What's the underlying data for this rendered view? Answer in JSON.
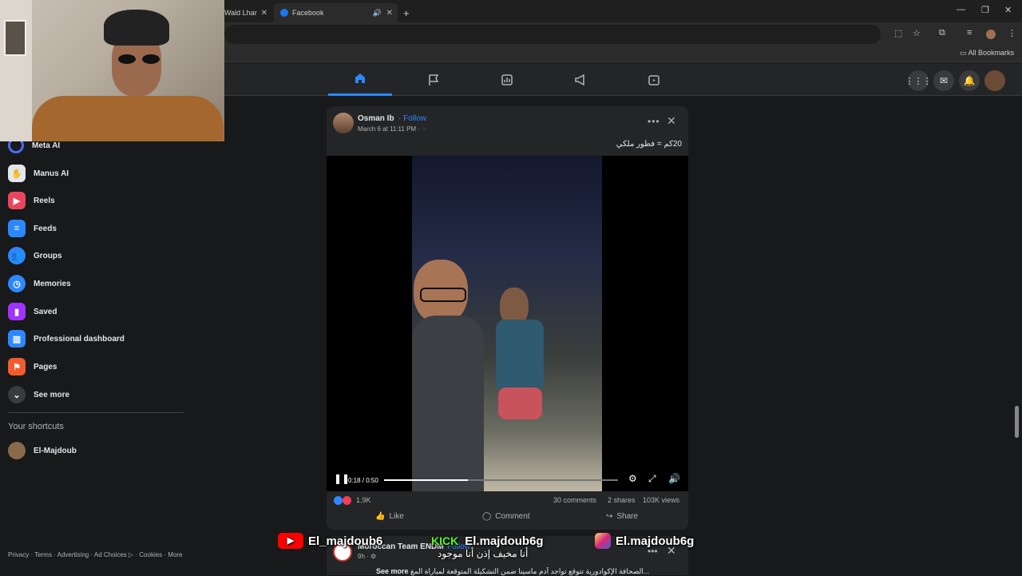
{
  "browser": {
    "tabs": [
      {
        "label": "Wald Lhar"
      },
      {
        "label": "Facebook"
      }
    ],
    "new_tab": "+",
    "bookmarks_label": "All Bookmarks"
  },
  "sidebar": {
    "items": [
      {
        "label": "Meta AI",
        "icon": "meta-ai-icon",
        "color": "#4a6cf7"
      },
      {
        "label": "Manus AI",
        "icon": "manus-ai-icon",
        "color": "#e4e6eb"
      },
      {
        "label": "Reels",
        "icon": "reels-icon",
        "color": "#e8465f"
      },
      {
        "label": "Feeds",
        "icon": "feeds-icon",
        "color": "#2d88ff"
      },
      {
        "label": "Groups",
        "icon": "groups-icon",
        "color": "#2d88ff"
      },
      {
        "label": "Memories",
        "icon": "memories-icon",
        "color": "#2d88ff"
      },
      {
        "label": "Saved",
        "icon": "saved-icon",
        "color": "#a033ff"
      },
      {
        "label": "Professional dashboard",
        "icon": "dashboard-icon",
        "color": "#2d88ff"
      },
      {
        "label": "Pages",
        "icon": "pages-icon",
        "color": "#f15b2e"
      },
      {
        "label": "See more",
        "icon": "chevron-down-icon",
        "color": "#3a3b3c"
      }
    ],
    "shortcuts_title": "Your shortcuts",
    "shortcuts": [
      {
        "label": "El-Majdoub"
      }
    ],
    "footer": "Privacy · Terms · Advertising · Ad Choices ▷ · Cookies · More"
  },
  "post": {
    "author": "Osman Ib",
    "follow": "· Follow",
    "date": "March 6 at 11:11 PM ·",
    "caption": "20كم = فطور ملكي",
    "video": {
      "time": "0:18 / 0:50",
      "progress": 0.36
    },
    "reactions": "1.9K",
    "comments": "30 comments",
    "shares": "2 shares",
    "views": "103K views",
    "actions": {
      "like": "Like",
      "comment": "Comment",
      "share": "Share"
    }
  },
  "post2": {
    "author": "Moroccan Team ENDM",
    "follow": "· Follow",
    "time": "9h ·",
    "caption": "الصحافة الإكوادورية تتوقع تواجد آدم ماسينا ضمن التشكيلة المتوقعة لمباراة المغ...",
    "see_more": "See more"
  },
  "overlays": {
    "youtube": "El_majdoub6",
    "kick_label": "KICK",
    "kick": "El.majdoub6g",
    "instagram": "El.majdoub6g",
    "subtitle": "أنا مخيف إذن أنا موجود"
  },
  "colors": {
    "accent": "#2d88ff",
    "bg": "#18191a",
    "card": "#242526"
  }
}
